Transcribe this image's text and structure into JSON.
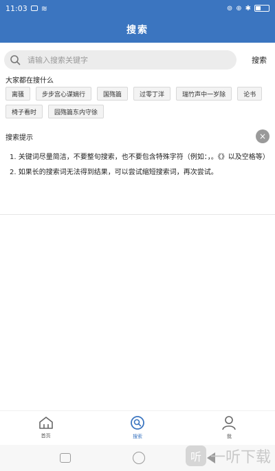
{
  "status_bar": {
    "time": "11:03",
    "indicators": [
      "camera-icon",
      "wifi-icon",
      "signal-icon",
      "bluetooth-icon"
    ],
    "battery": "battery-icon"
  },
  "header": {
    "title": "搜索"
  },
  "search": {
    "placeholder": "请输入搜索关键字",
    "button_label": "搜索"
  },
  "hot": {
    "title": "大家都在搜什么",
    "tags": [
      "离骚",
      "步步宫心谋嫡行",
      "国殇篇",
      "过零丁洋",
      "瑞竹声中一岁除",
      "论书",
      "椅子看时",
      "园殇篇东内守徐"
    ]
  },
  "tips": {
    "title": "搜索提示",
    "items": [
      "1. 关键词尽量简洁，不要整句搜索，也不要包含特殊字符（例如：，。《》以及空格等）",
      "2. 如果长的搜索词无法得到结果，可以尝试缩短搜索词，再次尝试。"
    ]
  },
  "tabbar": {
    "items": [
      {
        "label": "首页",
        "icon": "home-icon"
      },
      {
        "label": "搜索",
        "icon": "search-icon"
      },
      {
        "label": "我",
        "icon": "user-icon"
      }
    ],
    "active_index": 1
  },
  "watermark": {
    "logo": "听",
    "text": "一听下载"
  },
  "colors": {
    "primary": "#3b75c0",
    "tag_bg": "#f3f3f3",
    "search_bg": "#ececec"
  }
}
